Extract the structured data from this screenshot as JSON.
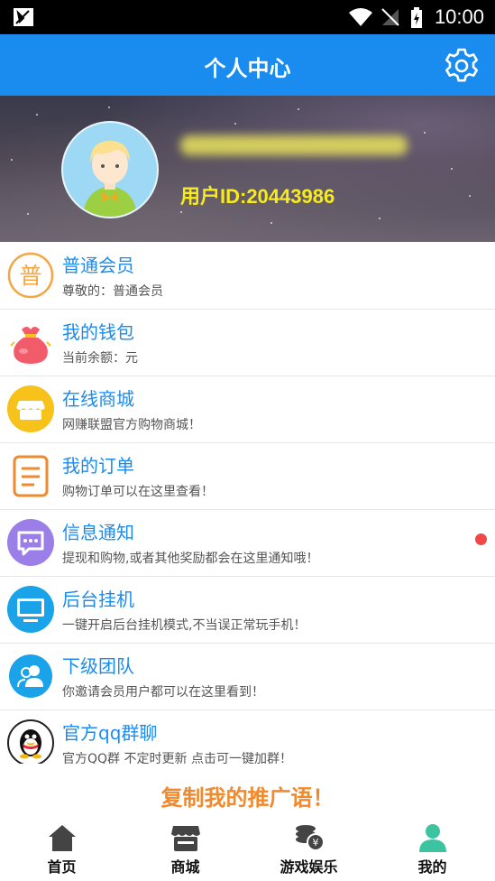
{
  "statusbar": {
    "time": "10:00"
  },
  "header": {
    "title": "个人中心"
  },
  "profile": {
    "user_id": "用户ID:20443986"
  },
  "menu": [
    {
      "title": "普通会员",
      "subtitle": "尊敬的：普通会员",
      "icon": "member-badge-icon",
      "icon_char": "普",
      "color": "#f5a544"
    },
    {
      "title": "我的钱包",
      "subtitle": "当前余额：元",
      "icon": "money-bag-icon",
      "color": "#f25b6a"
    },
    {
      "title": "在线商城",
      "subtitle": "网赚联盟官方购物商城！",
      "icon": "shop-icon",
      "color": "#f7c21a"
    },
    {
      "title": "我的订单",
      "subtitle": "购物订单可以在这里查看！",
      "icon": "order-document-icon",
      "color": "#f08a2e"
    },
    {
      "title": "信息通知",
      "subtitle": "提现和购物,或者其他奖励都会在这里通知哦！",
      "icon": "message-icon",
      "color": "#9b7ee8"
    },
    {
      "title": "后台挂机",
      "subtitle": "一键开启后台挂机模式,不当误正常玩手机！",
      "icon": "monitor-icon",
      "color": "#1aa3e8"
    },
    {
      "title": "下级团队",
      "subtitle": "你邀请会员用户都可以在这里看到！",
      "icon": "team-icon",
      "color": "#1aa3e8"
    },
    {
      "title": "官方qq群聊",
      "subtitle": "官方QQ群 不定时更新 点击可一键加群！",
      "icon": "qq-penguin-icon",
      "color": "#222222"
    }
  ],
  "promo": {
    "label": "复制我的推广语！"
  },
  "tabs": [
    {
      "label": "首页",
      "icon": "home-icon"
    },
    {
      "label": "商城",
      "icon": "store-icon"
    },
    {
      "label": "游戏娱乐",
      "icon": "coins-icon"
    },
    {
      "label": "我的",
      "icon": "person-icon"
    }
  ],
  "colors": {
    "primary": "#1a8cf0",
    "accent": "#f08a2e",
    "active_tab": "#3cc4a0",
    "user_id": "#f7ea1e"
  }
}
